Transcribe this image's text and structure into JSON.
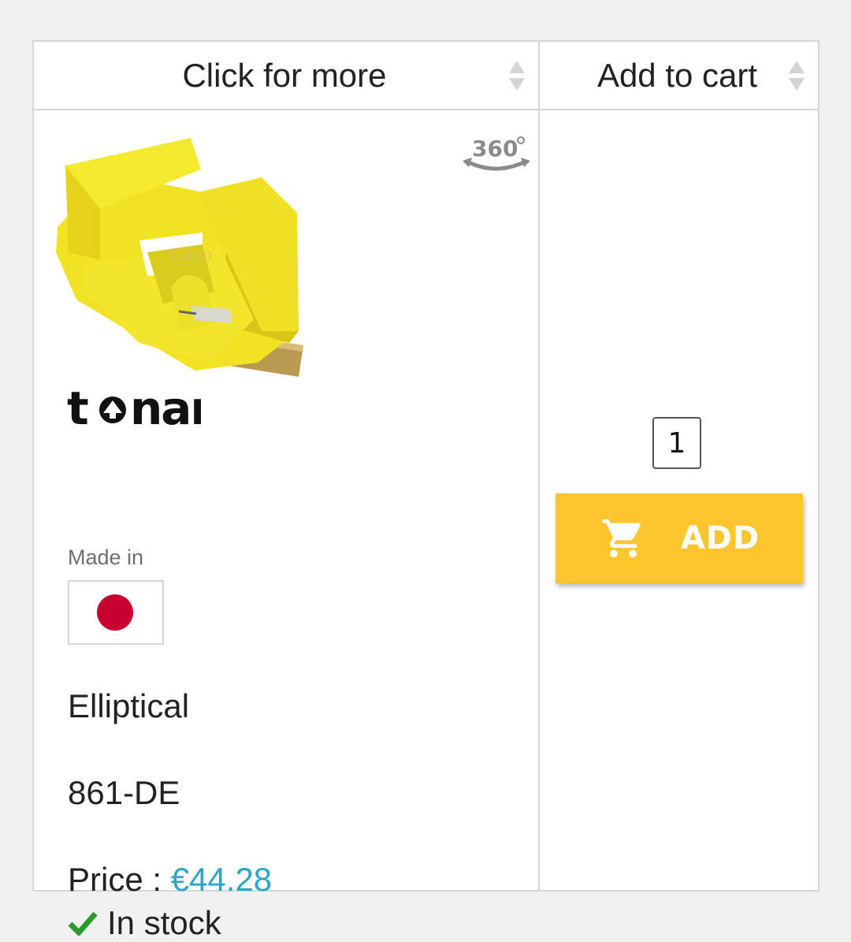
{
  "table": {
    "columns": [
      {
        "label": "Click for more"
      },
      {
        "label": "Add to cart"
      }
    ]
  },
  "product": {
    "brand": "tonar",
    "made_in_label": "Made in",
    "country_flag": "japan-flag",
    "stylus_type": "Elliptical",
    "model": "861-DE",
    "price_label": "Price :",
    "price_value": "€44.28",
    "stock_status": "In stock",
    "image_watermark": "Capo audio",
    "view_360_label": "360°"
  },
  "cart": {
    "quantity": "1",
    "add_label": "ADD"
  },
  "colors": {
    "accent_button": "#fec52e",
    "price": "#2aa6c9",
    "stock_check": "#2c9a2c",
    "flag_red": "#c8002f",
    "border": "#d6d6d6"
  }
}
